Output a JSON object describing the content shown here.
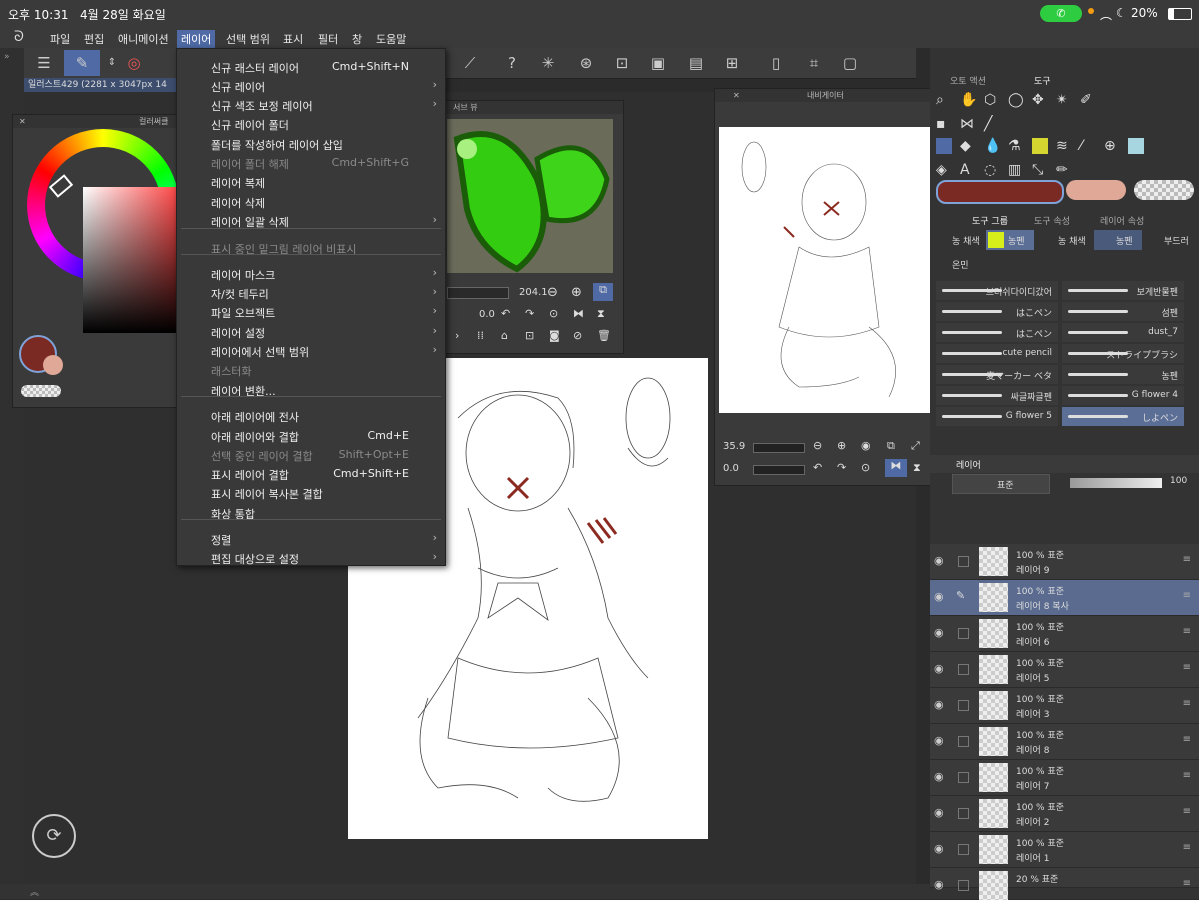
{
  "status": {
    "time": "오후 10:31",
    "date": "4월 28일 화요일",
    "battery": "20%"
  },
  "menubar": {
    "items": [
      "파일",
      "편집",
      "애니메이션",
      "레이어",
      "선택 범위",
      "표시",
      "필터",
      "창",
      "도움말"
    ],
    "active": "레이어"
  },
  "document_tab": "일러스트429 (2281 x 3047px 14",
  "panels": {
    "color_title": "컬러써클",
    "subview_title": "서브 뷰",
    "subview_zoom": "204.1",
    "subview_angle": "0.0",
    "navigator_title": "내비게이터",
    "navigator_zoom": "35.9",
    "navigator_angle": "0.0"
  },
  "dropdown": {
    "items": [
      {
        "label": "신규 래스터 레이어",
        "shortcut": "Cmd+Shift+N",
        "disabled": false,
        "sub": false
      },
      {
        "label": "신규 레이어",
        "shortcut": "",
        "disabled": false,
        "sub": true
      },
      {
        "label": "신규 색조 보정 레이어",
        "shortcut": "",
        "disabled": false,
        "sub": true
      },
      {
        "label": "신규 레이어 폴더",
        "shortcut": "",
        "disabled": false,
        "sub": false
      },
      {
        "label": "폴더를 작성하여 레이어 삽입",
        "shortcut": "",
        "disabled": false,
        "sub": false
      },
      {
        "label": "레이어 폴더 해제",
        "shortcut": "Cmd+Shift+G",
        "disabled": true,
        "sub": false
      },
      {
        "label": "레이어 복제",
        "shortcut": "",
        "disabled": false,
        "sub": false
      },
      {
        "label": "레이어 삭제",
        "shortcut": "",
        "disabled": false,
        "sub": false
      },
      {
        "label": "레이어 일괄 삭제",
        "shortcut": "",
        "disabled": false,
        "sub": true
      },
      {
        "label": "표시 중인 밑그림 레이어 비표시",
        "shortcut": "",
        "disabled": true,
        "sub": false
      },
      {
        "label": "레이어 마스크",
        "shortcut": "",
        "disabled": false,
        "sub": true
      },
      {
        "label": "자/컷 테두리",
        "shortcut": "",
        "disabled": false,
        "sub": true
      },
      {
        "label": "파일 오브젝트",
        "shortcut": "",
        "disabled": false,
        "sub": true
      },
      {
        "label": "레이어 설정",
        "shortcut": "",
        "disabled": false,
        "sub": true
      },
      {
        "label": "레이어에서 선택 범위",
        "shortcut": "",
        "disabled": false,
        "sub": true
      },
      {
        "label": "래스터화",
        "shortcut": "",
        "disabled": true,
        "sub": false
      },
      {
        "label": "레이어 변환...",
        "shortcut": "",
        "disabled": false,
        "sub": false
      },
      {
        "label": "아래 레이어에 전사",
        "shortcut": "",
        "disabled": false,
        "sub": false
      },
      {
        "label": "아래 레이어와 결합",
        "shortcut": "Cmd+E",
        "disabled": false,
        "sub": false
      },
      {
        "label": "선택 중인 레이어 결합",
        "shortcut": "Shift+Opt+E",
        "disabled": true,
        "sub": false
      },
      {
        "label": "표시 레이어 결합",
        "shortcut": "Cmd+Shift+E",
        "disabled": false,
        "sub": false
      },
      {
        "label": "표시 레이어 복사본 결합",
        "shortcut": "",
        "disabled": false,
        "sub": false
      },
      {
        "label": "화상 통합",
        "shortcut": "",
        "disabled": false,
        "sub": false
      },
      {
        "label": "정렬",
        "shortcut": "",
        "disabled": false,
        "sub": true
      },
      {
        "label": "편집 대상으로 설정",
        "shortcut": "",
        "disabled": false,
        "sub": true
      }
    ]
  },
  "right": {
    "tabs_top": [
      "오토 액션",
      "도구"
    ],
    "subtool_tabs": [
      "도구 그룹",
      "도구 속성",
      "레이어 속성"
    ],
    "pen_tools": [
      "농 채색",
      "농펜",
      "농 채색",
      "농펜",
      "부드러",
      "온민"
    ],
    "brushes": [
      [
        "브러쉬다이디갔어",
        "보게반물펜"
      ],
      [
        "はこペン",
        "섬펜"
      ],
      [
        "はこペン",
        "dust_7"
      ],
      [
        "cute pencil",
        "ストライプブラシ"
      ],
      [
        "麦マーカー ベタ",
        "농펜"
      ],
      [
        "싸글짜글펜",
        "G flower 4"
      ],
      [
        "G flower 5",
        "しよペン"
      ]
    ],
    "layer_panel_title": "레이어",
    "blend_mode": "표준",
    "opacity": "100",
    "layers": [
      {
        "pct": "100 %",
        "mode": "표준",
        "name": "레이어 9"
      },
      {
        "pct": "100 %",
        "mode": "표준",
        "name": "레이어 8 복사"
      },
      {
        "pct": "100 %",
        "mode": "표준",
        "name": "레이어 6"
      },
      {
        "pct": "100 %",
        "mode": "표준",
        "name": "레이어 5"
      },
      {
        "pct": "100 %",
        "mode": "표준",
        "name": "레이어 3"
      },
      {
        "pct": "100 %",
        "mode": "표준",
        "name": "레이어 8"
      },
      {
        "pct": "100 %",
        "mode": "표준",
        "name": "레이어 7"
      },
      {
        "pct": "100 %",
        "mode": "표준",
        "name": "레이어 2"
      },
      {
        "pct": "100 %",
        "mode": "표준",
        "name": "레이어 1"
      },
      {
        "pct": "20 %",
        "mode": "표준",
        "name": ""
      }
    ]
  },
  "colors": {
    "main": "#7a2a22",
    "sub": "#e0a896",
    "accent": "#4f6aa5"
  }
}
